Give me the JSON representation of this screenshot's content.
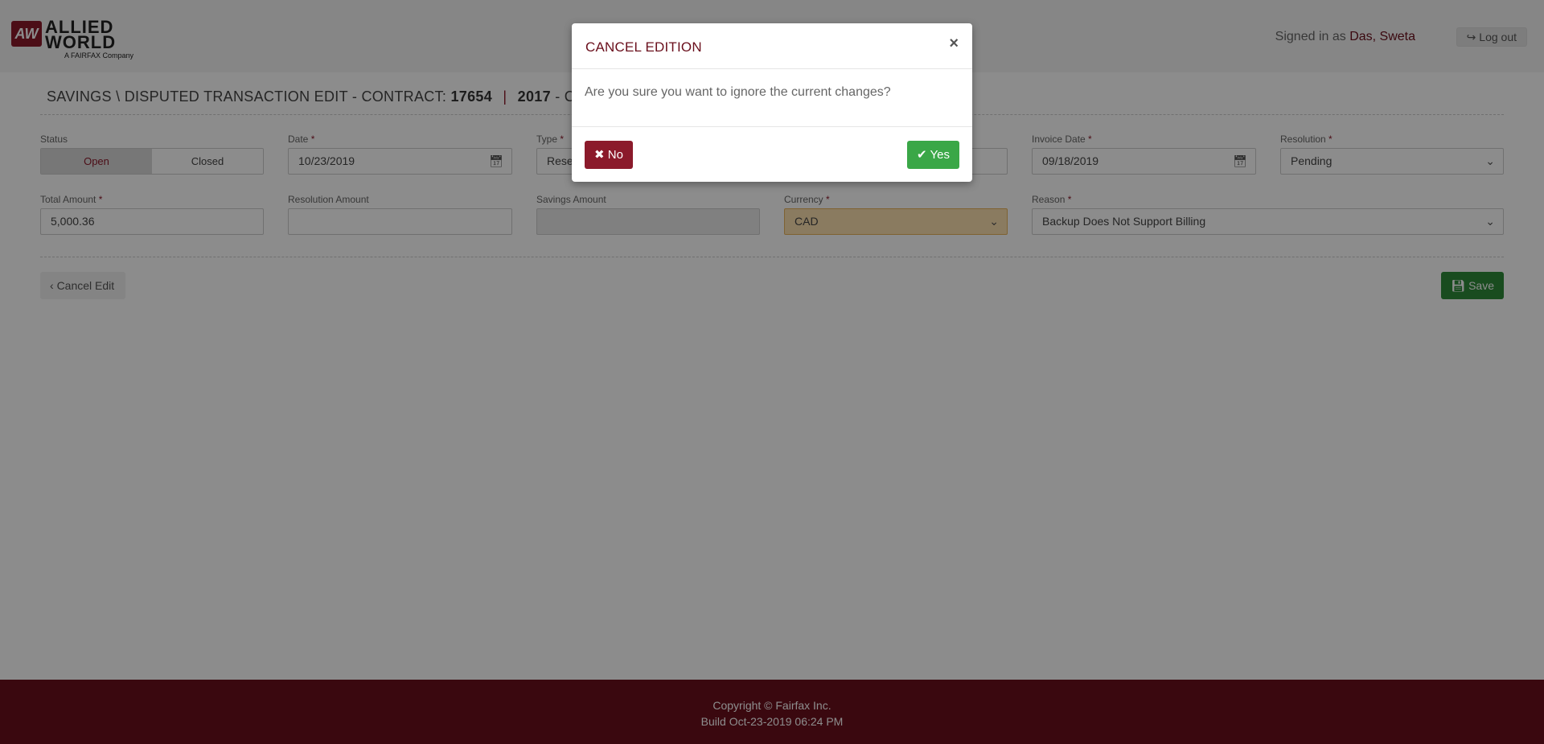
{
  "header": {
    "logo": {
      "line1": "ALLIED",
      "line2": "WORLD",
      "subtitle": "A FAIRFAX Company",
      "mark": "AW"
    },
    "signed_in_prefix": "Signed in as",
    "user_name": "Das, Sweta",
    "logout_icon": "sign-out-icon",
    "logout_label": "Log out"
  },
  "page": {
    "title_prefix": "SAVINGS \\ DISPUTED TRANSACTION EDIT - CONTRACT:",
    "contract": "17654",
    "separator": "|",
    "year": "2017",
    "title_suffix": "- CLA"
  },
  "form": {
    "status": {
      "label": "Status",
      "options": [
        "Open",
        "Closed"
      ],
      "selected": "Open"
    },
    "date": {
      "label": "Date",
      "value": "10/23/2019"
    },
    "type": {
      "label": "Type",
      "value": "Rese"
    },
    "invoice_date": {
      "label": "Invoice Date",
      "value": "09/18/2019"
    },
    "resolution": {
      "label": "Resolution",
      "value": "Pending"
    },
    "total_amount": {
      "label": "Total Amount",
      "value": "5,000.36"
    },
    "resolution_amount": {
      "label": "Resolution Amount",
      "value": ""
    },
    "savings_amount": {
      "label": "Savings Amount",
      "value": ""
    },
    "currency": {
      "label": "Currency",
      "value": "CAD"
    },
    "reason": {
      "label": "Reason",
      "value": "Backup Does Not Support Billing"
    },
    "required_mark": "*"
  },
  "actions": {
    "cancel_label": "Cancel Edit",
    "save_label": "Save"
  },
  "footer": {
    "copyright": "Copyright © Fairfax Inc.",
    "build": "Build Oct-23-2019 06:24 PM"
  },
  "modal": {
    "title": "CANCEL EDITION",
    "close": "×",
    "message": "Are you sure you want to ignore the current changes?",
    "no_label": "No",
    "yes_label": "Yes"
  },
  "colors": {
    "brand": "#8b1a2b",
    "footer": "#6a0f1c",
    "success": "#3aa747",
    "warning_field": "#fbe0b0"
  }
}
